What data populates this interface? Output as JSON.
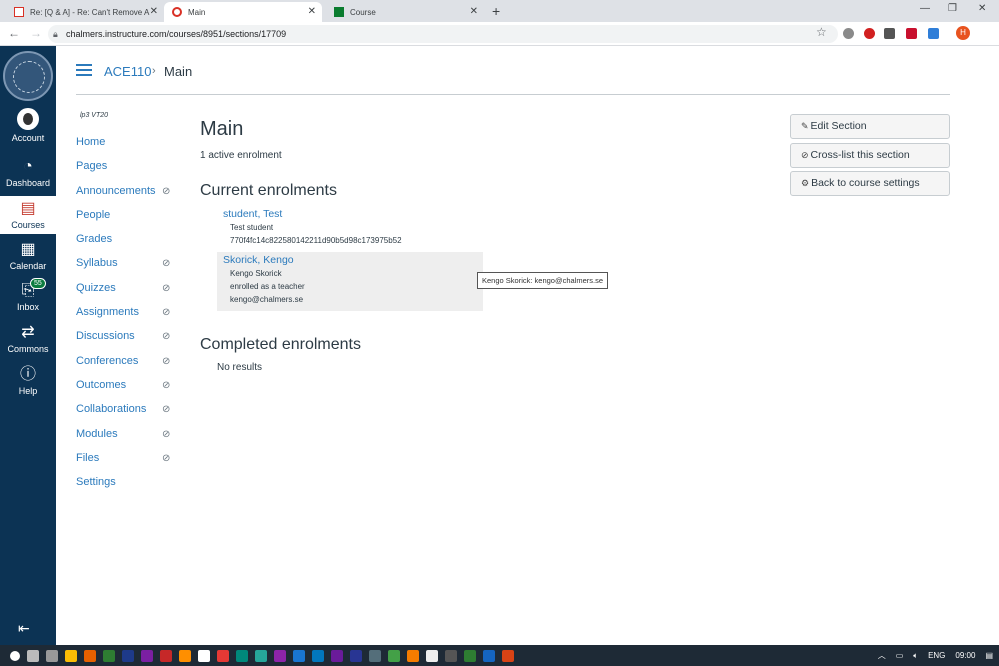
{
  "browser": {
    "tabs": [
      {
        "title": "Re: [Q & A] - Re: Can't Remove A"
      },
      {
        "title": "Main"
      },
      {
        "title": "Course"
      }
    ],
    "url": "chalmers.instructure.com/courses/8951/sections/17709",
    "profile_initial": "H"
  },
  "global_nav": {
    "items": [
      {
        "label": "Account",
        "icon": "avatar"
      },
      {
        "label": "Dashboard",
        "icon": "dashboard-icon"
      },
      {
        "label": "Courses",
        "icon": "book-icon"
      },
      {
        "label": "Calendar",
        "icon": "calendar-icon"
      },
      {
        "label": "Inbox",
        "icon": "inbox-icon",
        "badge": "55"
      },
      {
        "label": "Commons",
        "icon": "commons-icon"
      },
      {
        "label": "Help",
        "icon": "help-icon"
      }
    ]
  },
  "breadcrumb": {
    "course": "ACE110",
    "section": "Main"
  },
  "course_nav": {
    "term": "lp3 VT20",
    "items": [
      {
        "label": "Home",
        "hidden": false
      },
      {
        "label": "Pages",
        "hidden": false
      },
      {
        "label": "Announcements",
        "hidden": true
      },
      {
        "label": "People",
        "hidden": false
      },
      {
        "label": "Grades",
        "hidden": false
      },
      {
        "label": "Syllabus",
        "hidden": true
      },
      {
        "label": "Quizzes",
        "hidden": true
      },
      {
        "label": "Assignments",
        "hidden": true
      },
      {
        "label": "Discussions",
        "hidden": true
      },
      {
        "label": "Conferences",
        "hidden": true
      },
      {
        "label": "Outcomes",
        "hidden": true
      },
      {
        "label": "Collaborations",
        "hidden": true
      },
      {
        "label": "Modules",
        "hidden": true
      },
      {
        "label": "Files",
        "hidden": true
      },
      {
        "label": "Settings",
        "hidden": false
      }
    ]
  },
  "main": {
    "title": "Main",
    "active_count": "1 active enrolment",
    "current_heading": "Current enrolments",
    "enrolments": [
      {
        "name": "student, Test",
        "lines": [
          "Test student",
          "770f4fc14c822580142211d90b5d98c173975b52"
        ]
      },
      {
        "name": "Skorick, Kengo",
        "lines": [
          "Kengo Skorick",
          "enrolled as a teacher",
          "kengo@chalmers.se"
        ]
      }
    ],
    "tooltip": "Kengo Skorick: kengo@chalmers.se",
    "completed_heading": "Completed enrolments",
    "no_results": "No results"
  },
  "actions": {
    "edit": "Edit Section",
    "crosslist": "Cross-list this section",
    "back": "Back to course settings"
  },
  "taskbar": {
    "lang": "ENG",
    "time": "09:00"
  }
}
